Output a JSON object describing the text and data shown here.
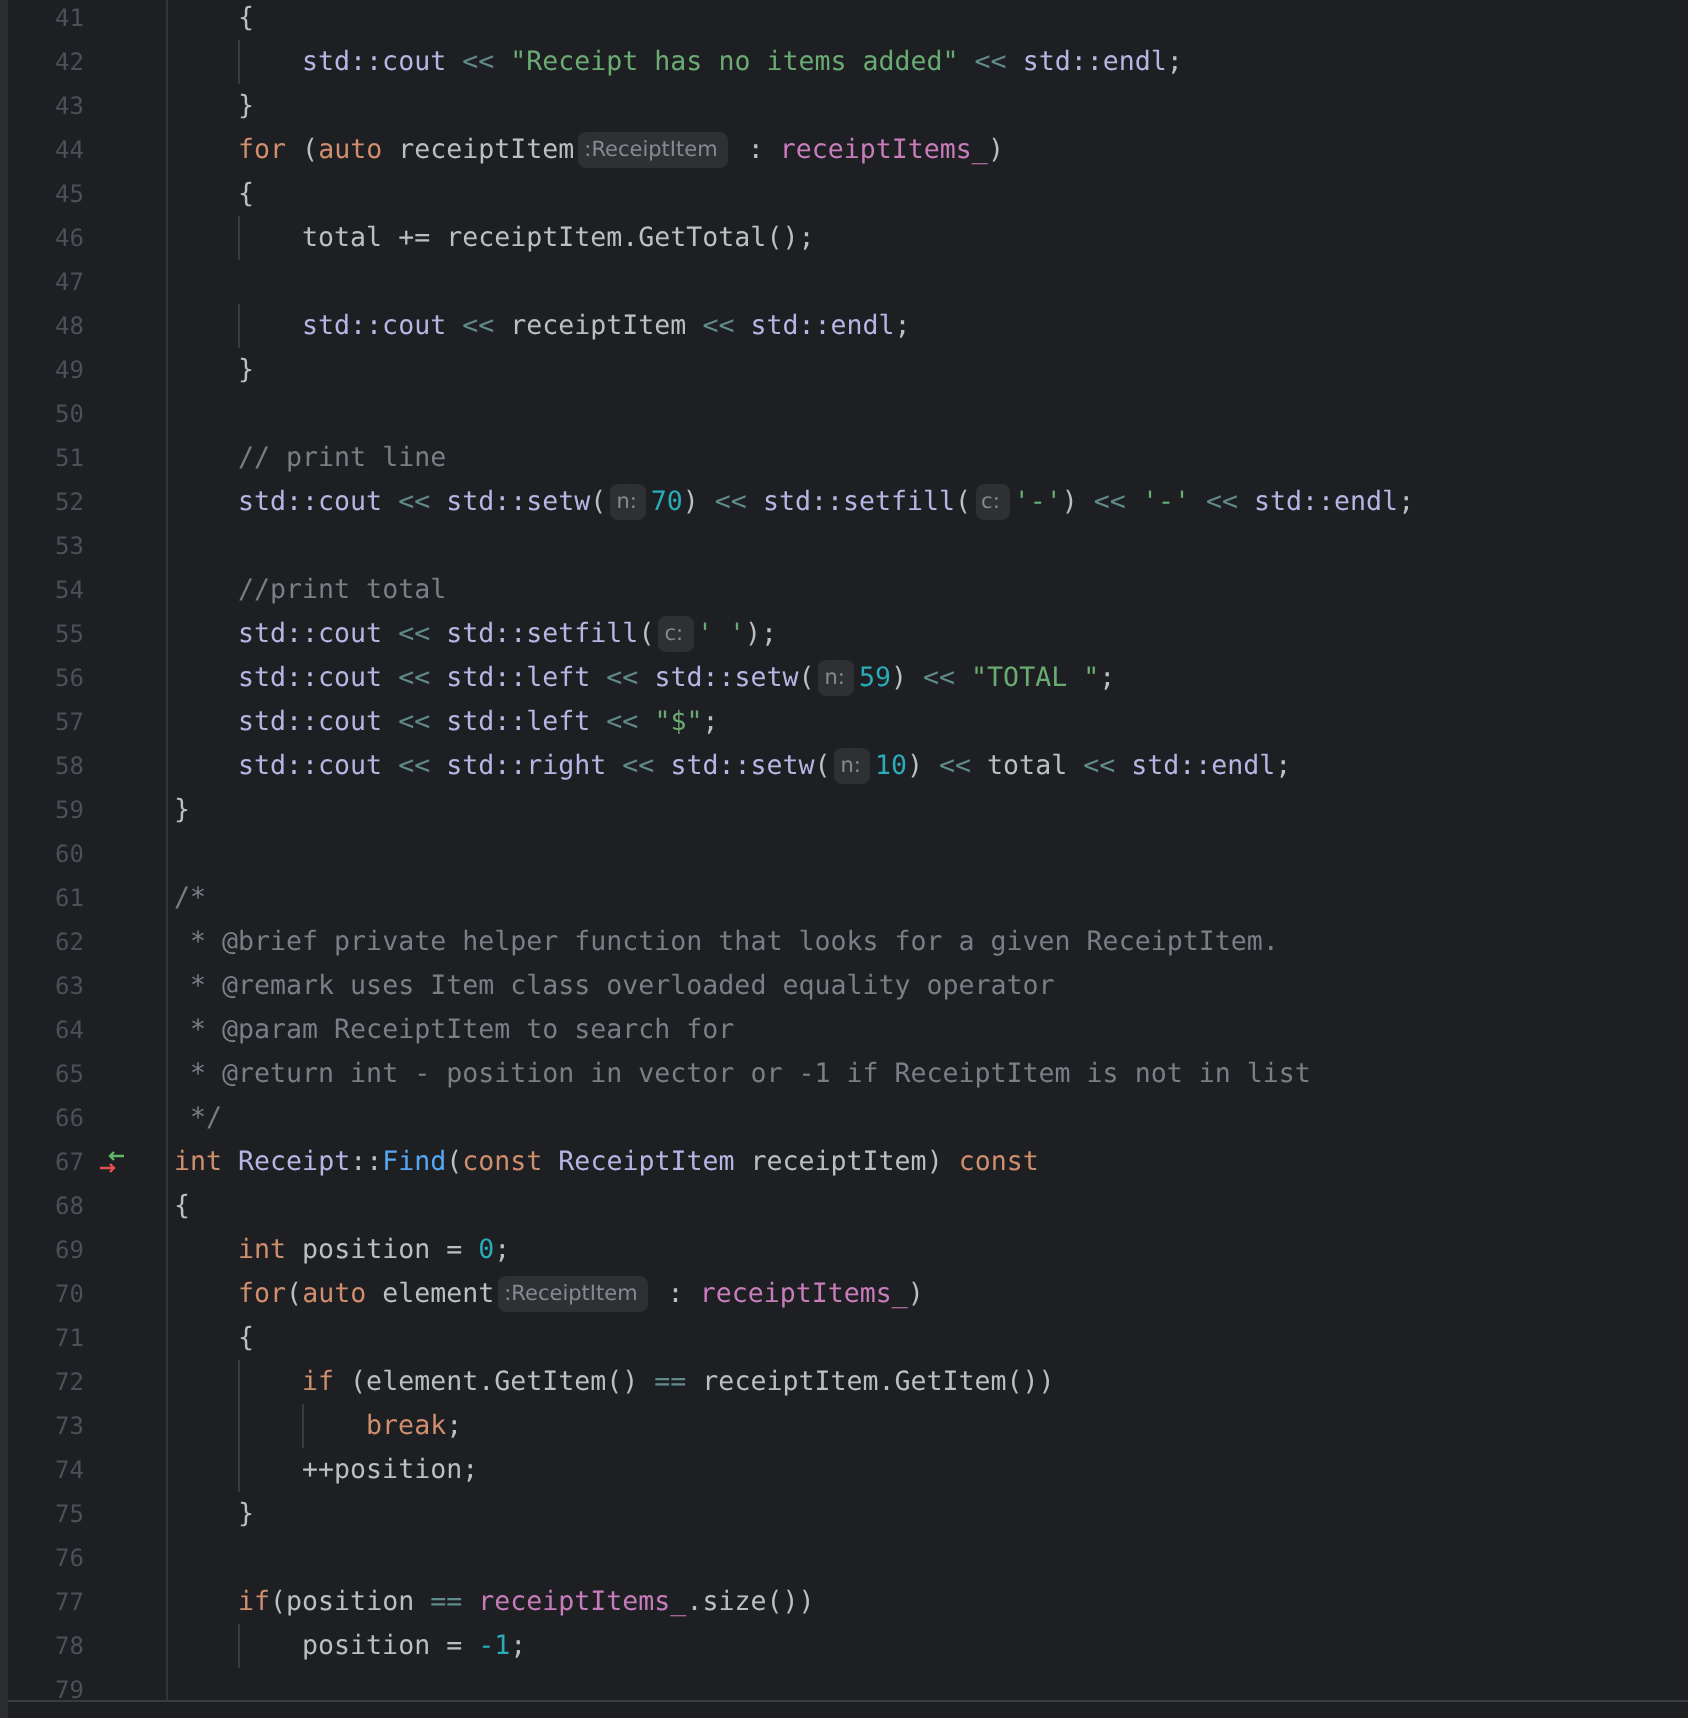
{
  "editor": {
    "lines": [
      {
        "number": "41",
        "marker": false,
        "tokens": [
          {
            "kind": "text",
            "text": "    {"
          }
        ]
      },
      {
        "number": "42",
        "marker": false,
        "tokens": [
          {
            "kind": "ns",
            "text": "        std::cout"
          },
          {
            "kind": "op",
            "text": " << "
          },
          {
            "kind": "str",
            "text": "\"Receipt has no items added\""
          },
          {
            "kind": "op",
            "text": " << "
          },
          {
            "kind": "ns",
            "text": "std::endl"
          },
          {
            "kind": "text",
            "text": ";"
          }
        ]
      },
      {
        "number": "43",
        "marker": false,
        "tokens": [
          {
            "kind": "text",
            "text": "    }"
          }
        ]
      },
      {
        "number": "44",
        "marker": false,
        "tokens": [
          {
            "kind": "kw",
            "text": "    for"
          },
          {
            "kind": "text",
            "text": " ("
          },
          {
            "kind": "kw",
            "text": "auto"
          },
          {
            "kind": "text",
            "text": " receiptItem"
          },
          {
            "kind": "hint",
            "text": ":ReceiptItem"
          },
          {
            "kind": "text",
            "text": " : "
          },
          {
            "kind": "field",
            "text": "receiptItems_"
          },
          {
            "kind": "text",
            "text": ")"
          }
        ]
      },
      {
        "number": "45",
        "marker": false,
        "tokens": [
          {
            "kind": "text",
            "text": "    {"
          }
        ]
      },
      {
        "number": "46",
        "marker": false,
        "tokens": [
          {
            "kind": "text",
            "text": "        total += receiptItem.GetTotal();"
          }
        ]
      },
      {
        "number": "47",
        "marker": false
      },
      {
        "number": "48",
        "marker": false,
        "tokens": [
          {
            "kind": "ns",
            "text": "        std::cout"
          },
          {
            "kind": "op",
            "text": " << "
          },
          {
            "kind": "text",
            "text": "receiptItem"
          },
          {
            "kind": "op",
            "text": " << "
          },
          {
            "kind": "ns",
            "text": "std::endl"
          },
          {
            "kind": "text",
            "text": ";"
          }
        ]
      },
      {
        "number": "49",
        "marker": false,
        "tokens": [
          {
            "kind": "text",
            "text": "    }"
          }
        ]
      },
      {
        "number": "50",
        "marker": false
      },
      {
        "number": "51",
        "marker": false,
        "tokens": [
          {
            "kind": "com",
            "text": "    // print line"
          }
        ]
      },
      {
        "number": "52",
        "marker": false,
        "tokens": [
          {
            "kind": "ns",
            "text": "    std::cout"
          },
          {
            "kind": "op",
            "text": " << "
          },
          {
            "kind": "ns",
            "text": "std::setw"
          },
          {
            "kind": "text",
            "text": "("
          },
          {
            "kind": "hint",
            "text": "n:"
          },
          {
            "kind": "num",
            "text": "70"
          },
          {
            "kind": "text",
            "text": ")"
          },
          {
            "kind": "op",
            "text": " << "
          },
          {
            "kind": "ns",
            "text": "std::setfill"
          },
          {
            "kind": "text",
            "text": "("
          },
          {
            "kind": "hint",
            "text": "c:"
          },
          {
            "kind": "str",
            "text": "'-'"
          },
          {
            "kind": "text",
            "text": ")"
          },
          {
            "kind": "op",
            "text": " << "
          },
          {
            "kind": "str",
            "text": "'-'"
          },
          {
            "kind": "op",
            "text": " << "
          },
          {
            "kind": "ns",
            "text": "std::endl"
          },
          {
            "kind": "text",
            "text": ";"
          }
        ]
      },
      {
        "number": "53",
        "marker": false
      },
      {
        "number": "54",
        "marker": false,
        "tokens": [
          {
            "kind": "com",
            "text": "    //print total"
          }
        ]
      },
      {
        "number": "55",
        "marker": false,
        "tokens": [
          {
            "kind": "ns",
            "text": "    std::cout"
          },
          {
            "kind": "op",
            "text": " << "
          },
          {
            "kind": "ns",
            "text": "std::setfill"
          },
          {
            "kind": "text",
            "text": "("
          },
          {
            "kind": "hint",
            "text": "c:"
          },
          {
            "kind": "str",
            "text": "' '"
          },
          {
            "kind": "text",
            "text": ");"
          }
        ]
      },
      {
        "number": "56",
        "marker": false,
        "tokens": [
          {
            "kind": "ns",
            "text": "    std::cout"
          },
          {
            "kind": "op",
            "text": " << "
          },
          {
            "kind": "ns",
            "text": "std::left"
          },
          {
            "kind": "op",
            "text": " << "
          },
          {
            "kind": "ns",
            "text": "std::setw"
          },
          {
            "kind": "text",
            "text": "("
          },
          {
            "kind": "hint",
            "text": "n:"
          },
          {
            "kind": "num",
            "text": "59"
          },
          {
            "kind": "text",
            "text": ")"
          },
          {
            "kind": "op",
            "text": " << "
          },
          {
            "kind": "str",
            "text": "\"TOTAL \""
          },
          {
            "kind": "text",
            "text": ";"
          }
        ]
      },
      {
        "number": "57",
        "marker": false,
        "tokens": [
          {
            "kind": "ns",
            "text": "    std::cout"
          },
          {
            "kind": "op",
            "text": " << "
          },
          {
            "kind": "ns",
            "text": "std::left"
          },
          {
            "kind": "op",
            "text": " << "
          },
          {
            "kind": "str",
            "text": "\"$\""
          },
          {
            "kind": "text",
            "text": ";"
          }
        ]
      },
      {
        "number": "58",
        "marker": false,
        "tokens": [
          {
            "kind": "ns",
            "text": "    std::cout"
          },
          {
            "kind": "op",
            "text": " << "
          },
          {
            "kind": "ns",
            "text": "std::right"
          },
          {
            "kind": "op",
            "text": " << "
          },
          {
            "kind": "ns",
            "text": "std::setw"
          },
          {
            "kind": "text",
            "text": "("
          },
          {
            "kind": "hint",
            "text": "n:"
          },
          {
            "kind": "num",
            "text": "10"
          },
          {
            "kind": "text",
            "text": ")"
          },
          {
            "kind": "op",
            "text": " << "
          },
          {
            "kind": "text",
            "text": "total"
          },
          {
            "kind": "op",
            "text": " << "
          },
          {
            "kind": "ns",
            "text": "std::endl"
          },
          {
            "kind": "text",
            "text": ";"
          }
        ]
      },
      {
        "number": "59",
        "marker": false,
        "tokens": [
          {
            "kind": "text",
            "text": "}"
          }
        ]
      },
      {
        "number": "60",
        "marker": false
      },
      {
        "number": "61",
        "marker": false,
        "tokens": [
          {
            "kind": "com",
            "text": "/*"
          }
        ]
      },
      {
        "number": "62",
        "marker": false,
        "tokens": [
          {
            "kind": "com",
            "text": " * @brief private helper function that looks for a given ReceiptItem."
          }
        ]
      },
      {
        "number": "63",
        "marker": false,
        "tokens": [
          {
            "kind": "com",
            "text": " * @remark uses Item class overloaded equality operator"
          }
        ]
      },
      {
        "number": "64",
        "marker": false,
        "tokens": [
          {
            "kind": "com",
            "text": " * @param ReceiptItem to search for"
          }
        ]
      },
      {
        "number": "65",
        "marker": false,
        "tokens": [
          {
            "kind": "com",
            "text": " * @return int - position in vector or -1 if ReceiptItem is not in list"
          }
        ]
      },
      {
        "number": "66",
        "marker": false,
        "tokens": [
          {
            "kind": "com",
            "text": " */"
          }
        ]
      },
      {
        "number": "67",
        "marker": true,
        "tokens": [
          {
            "kind": "kw",
            "text": "int"
          },
          {
            "kind": "ns",
            "text": " Receipt"
          },
          {
            "kind": "text",
            "text": "::"
          },
          {
            "kind": "fn",
            "text": "Find"
          },
          {
            "kind": "text",
            "text": "("
          },
          {
            "kind": "kw",
            "text": "const"
          },
          {
            "kind": "ns",
            "text": " ReceiptItem"
          },
          {
            "kind": "text",
            "text": " receiptItem) "
          },
          {
            "kind": "kw",
            "text": "const"
          }
        ]
      },
      {
        "number": "68",
        "marker": false,
        "tokens": [
          {
            "kind": "text",
            "text": "{"
          }
        ]
      },
      {
        "number": "69",
        "marker": false,
        "tokens": [
          {
            "kind": "kw",
            "text": "    int"
          },
          {
            "kind": "text",
            "text": " position = "
          },
          {
            "kind": "num",
            "text": "0"
          },
          {
            "kind": "text",
            "text": ";"
          }
        ]
      },
      {
        "number": "70",
        "marker": false,
        "tokens": [
          {
            "kind": "kw",
            "text": "    for"
          },
          {
            "kind": "text",
            "text": "("
          },
          {
            "kind": "kw",
            "text": "auto"
          },
          {
            "kind": "text",
            "text": " element"
          },
          {
            "kind": "hint",
            "text": ":ReceiptItem"
          },
          {
            "kind": "text",
            "text": " : "
          },
          {
            "kind": "field",
            "text": "receiptItems_"
          },
          {
            "kind": "text",
            "text": ")"
          }
        ]
      },
      {
        "number": "71",
        "marker": false,
        "tokens": [
          {
            "kind": "text",
            "text": "    {"
          }
        ]
      },
      {
        "number": "72",
        "marker": false,
        "tokens": [
          {
            "kind": "kw",
            "text": "        if"
          },
          {
            "kind": "text",
            "text": " (element.GetItem() "
          },
          {
            "kind": "op",
            "text": "=="
          },
          {
            "kind": "text",
            "text": " receiptItem.GetItem())"
          }
        ]
      },
      {
        "number": "73",
        "marker": false,
        "tokens": [
          {
            "kind": "kw",
            "text": "            break"
          },
          {
            "kind": "text",
            "text": ";"
          }
        ]
      },
      {
        "number": "74",
        "marker": false,
        "tokens": [
          {
            "kind": "text",
            "text": "        ++position;"
          }
        ]
      },
      {
        "number": "75",
        "marker": false,
        "tokens": [
          {
            "kind": "text",
            "text": "    }"
          }
        ]
      },
      {
        "number": "76",
        "marker": false
      },
      {
        "number": "77",
        "marker": false,
        "tokens": [
          {
            "kind": "kw",
            "text": "    if"
          },
          {
            "kind": "text",
            "text": "(position "
          },
          {
            "kind": "op",
            "text": "=="
          },
          {
            "kind": "field",
            "text": " receiptItems_"
          },
          {
            "kind": "text",
            "text": ".size())"
          }
        ]
      },
      {
        "number": "78",
        "marker": false,
        "tokens": [
          {
            "kind": "text",
            "text": "        position = "
          },
          {
            "kind": "num",
            "text": "-1"
          },
          {
            "kind": "text",
            "text": ";"
          }
        ]
      },
      {
        "number": "79",
        "marker": false
      }
    ]
  }
}
